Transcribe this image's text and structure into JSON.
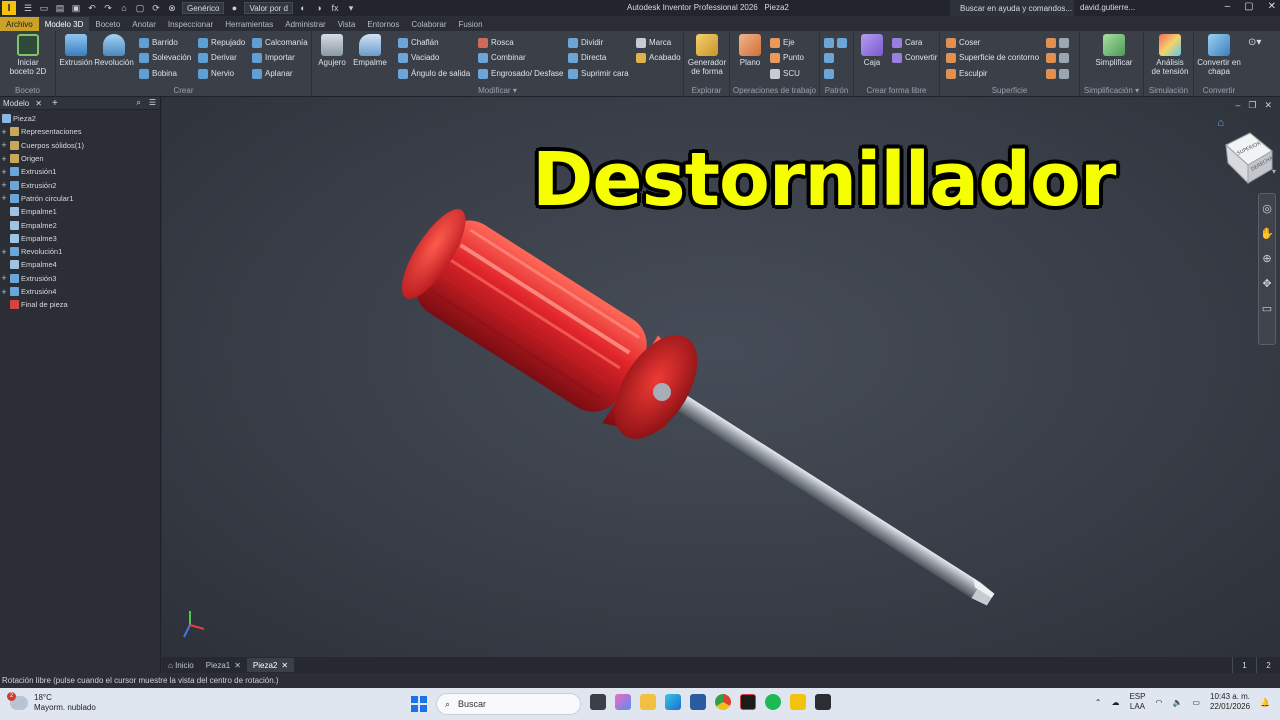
{
  "titlebar": {
    "logo": "I",
    "style_combo": "Genérico",
    "value_combo": "Valor por d",
    "fx": "fx",
    "app_title": "Autodesk Inventor Professional 2026",
    "doc_title": "Pieza2",
    "search_help": "Buscar en ayuda y comandos...",
    "user": "david.gutierre..."
  },
  "tabs": [
    "Archivo",
    "Modelo 3D",
    "Boceto",
    "Anotar",
    "Inspeccionar",
    "Herramientas",
    "Administrar",
    "Vista",
    "Entornos",
    "Colaborar",
    "Fusion"
  ],
  "ribbon": {
    "boceto": {
      "label": "Boceto",
      "btn": "Iniciar\nboceto 2D"
    },
    "crear": {
      "label": "Crear",
      "extrusion": "Extrusión",
      "revolucion": "Revolución",
      "small": [
        "Barrido",
        "Solevación",
        "Bobina",
        "Repujado",
        "Derivar",
        "Nervio",
        "Calcomanía",
        "Importar",
        "Aplanar"
      ]
    },
    "modificar": {
      "label": "Modificar",
      "agujero": "Agujero",
      "empalme": "Empalme",
      "small": [
        "Chaflán",
        "Vaciado",
        "Ángulo de salida",
        "Rosca",
        "Combinar",
        "Engrosado/ Desfase",
        "Dividir",
        "Directa",
        "Suprimir cara",
        "Marca",
        "Acabado"
      ]
    },
    "explorar": {
      "label": "Explorar",
      "btn": "Generador\nde forma"
    },
    "operaciones": {
      "label": "Operaciones de trabajo",
      "plano": "Plano",
      "small": [
        "Eje",
        "Punto",
        "SCU"
      ]
    },
    "patron": {
      "label": "Patrón"
    },
    "forma_libre": {
      "label": "Crear forma libre",
      "caja": "Caja",
      "small": [
        "Cara",
        "Convertir"
      ]
    },
    "superficie": {
      "label": "Superficie",
      "small": [
        "Coser",
        "Superficie de contorno",
        "Esculpir"
      ]
    },
    "simplificacion": {
      "label": "Simplificación",
      "btn": "Simplificar"
    },
    "simulacion": {
      "label": "Simulación",
      "btn": "Análisis\nde tensión"
    },
    "convertir": {
      "label": "Convertir",
      "btn": "Convertir en\nchapa"
    }
  },
  "browser": {
    "tab": "Modelo",
    "root": "Pieza2",
    "nodes": [
      {
        "label": "Representaciones",
        "exp": "+",
        "color": "#c8a95a"
      },
      {
        "label": "Cuerpos sólidos(1)",
        "exp": "+",
        "color": "#c8a95a"
      },
      {
        "label": "Origen",
        "exp": "+",
        "color": "#c8a95a"
      },
      {
        "label": "Extrusión1",
        "exp": "+",
        "color": "#6aa7d8"
      },
      {
        "label": "Extrusión2",
        "exp": "+",
        "color": "#6aa7d8"
      },
      {
        "label": "Patrón circular1",
        "exp": "+",
        "color": "#6aa7d8"
      },
      {
        "label": "Empalme1",
        "exp": "",
        "color": "#9fc3e2"
      },
      {
        "label": "Empalme2",
        "exp": "",
        "color": "#9fc3e2"
      },
      {
        "label": "Empalme3",
        "exp": "",
        "color": "#9fc3e2"
      },
      {
        "label": "Revolución1",
        "exp": "+",
        "color": "#6aa7d8"
      },
      {
        "label": "Empalme4",
        "exp": "",
        "color": "#9fc3e2"
      },
      {
        "label": "Extrusión3",
        "exp": "+",
        "color": "#6aa7d8"
      },
      {
        "label": "Extrusión4",
        "exp": "+",
        "color": "#6aa7d8"
      },
      {
        "label": "Final de pieza",
        "exp": "",
        "color": "#d6453b"
      }
    ]
  },
  "viewport": {
    "overlay_title": "Destornillador",
    "viewcube_top": "SUPERIOR",
    "viewcube_right": "DERECHA"
  },
  "doctabs": {
    "home": "Inicio",
    "tabs": [
      "Pieza1",
      "Pieza2"
    ],
    "pages": [
      "1",
      "2"
    ]
  },
  "status": "Rotación libre (pulse cuando el cursor muestre la vista del centro de rotación.)",
  "taskbar": {
    "weather_temp": "18°C",
    "weather_desc": "Mayorm. nublado",
    "weather_badge": "2",
    "search": "Buscar",
    "lang1": "ESP",
    "lang2": "LAA",
    "time": "10:43 a. m.",
    "date": "22/01/2026"
  }
}
